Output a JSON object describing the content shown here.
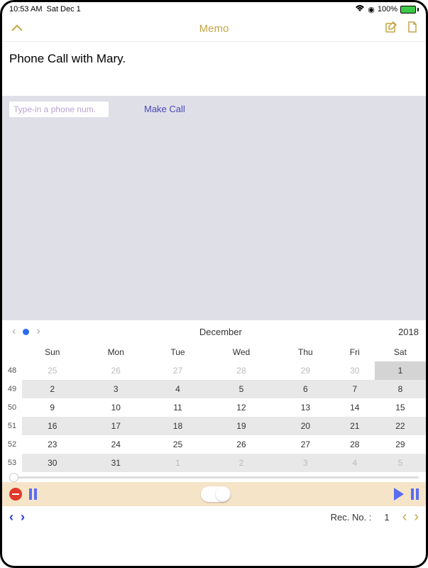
{
  "status": {
    "time": "10:53 AM",
    "date": "Sat Dec 1",
    "battery_pct": "100%"
  },
  "nav": {
    "title": "Memo"
  },
  "memo": {
    "text": "Phone Call with Mary."
  },
  "phone": {
    "placeholder": "Type-in a phone num.",
    "make_call": "Make Call"
  },
  "calendar": {
    "month": "December",
    "year": "2018",
    "day_headers": [
      "Sun",
      "Mon",
      "Tue",
      "Wed",
      "Thu",
      "Fri",
      "Sat"
    ],
    "weeks": [
      {
        "wk": "48",
        "days": [
          {
            "d": "25",
            "o": true
          },
          {
            "d": "26",
            "o": true
          },
          {
            "d": "27",
            "o": true
          },
          {
            "d": "28",
            "o": true
          },
          {
            "d": "29",
            "o": true
          },
          {
            "d": "30",
            "o": true
          },
          {
            "d": "1",
            "today": true
          }
        ],
        "shaded": false
      },
      {
        "wk": "49",
        "days": [
          {
            "d": "2"
          },
          {
            "d": "3"
          },
          {
            "d": "4"
          },
          {
            "d": "5"
          },
          {
            "d": "6"
          },
          {
            "d": "7"
          },
          {
            "d": "8"
          }
        ],
        "shaded": true
      },
      {
        "wk": "50",
        "days": [
          {
            "d": "9"
          },
          {
            "d": "10"
          },
          {
            "d": "11"
          },
          {
            "d": "12"
          },
          {
            "d": "13"
          },
          {
            "d": "14"
          },
          {
            "d": "15"
          }
        ],
        "shaded": false
      },
      {
        "wk": "51",
        "days": [
          {
            "d": "16"
          },
          {
            "d": "17"
          },
          {
            "d": "18"
          },
          {
            "d": "19"
          },
          {
            "d": "20"
          },
          {
            "d": "21"
          },
          {
            "d": "22"
          }
        ],
        "shaded": true
      },
      {
        "wk": "52",
        "days": [
          {
            "d": "23"
          },
          {
            "d": "24"
          },
          {
            "d": "25"
          },
          {
            "d": "26"
          },
          {
            "d": "27"
          },
          {
            "d": "28"
          },
          {
            "d": "29"
          }
        ],
        "shaded": false
      },
      {
        "wk": "53",
        "days": [
          {
            "d": "30"
          },
          {
            "d": "31"
          },
          {
            "d": "1",
            "o": true
          },
          {
            "d": "2",
            "o": true
          },
          {
            "d": "3",
            "o": true
          },
          {
            "d": "4",
            "o": true
          },
          {
            "d": "5",
            "o": true
          }
        ],
        "shaded": true
      }
    ]
  },
  "bottom": {
    "rec_label": "Rec. No. :",
    "rec_num": "1"
  }
}
